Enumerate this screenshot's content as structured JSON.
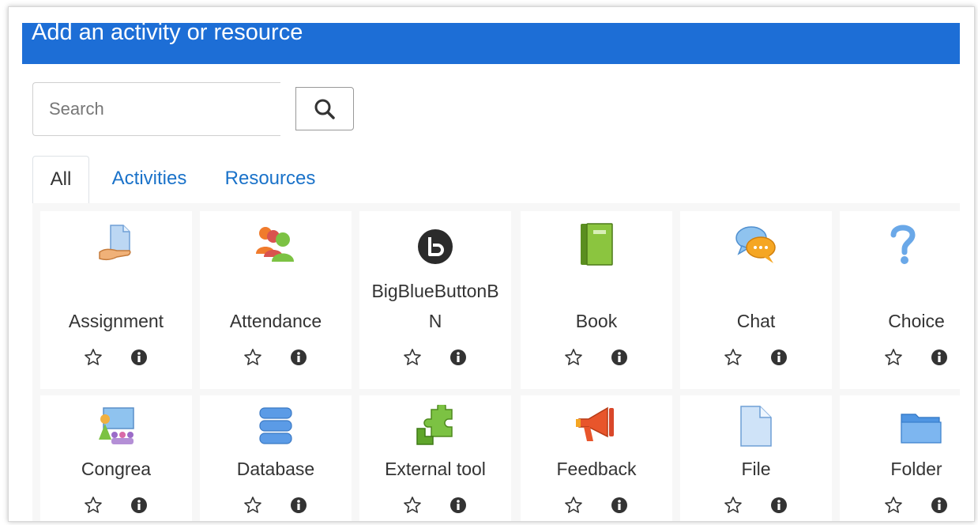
{
  "modal": {
    "title": "Add an activity or resource"
  },
  "search": {
    "placeholder": "Search"
  },
  "tabs": [
    {
      "label": "All",
      "active": true
    },
    {
      "label": "Activities",
      "active": false
    },
    {
      "label": "Resources",
      "active": false
    }
  ],
  "colors": {
    "header": "#1d6ed6",
    "link": "#1a72c9"
  },
  "modules": [
    {
      "name": "Assignment",
      "icon": "assignment-icon"
    },
    {
      "name": "Attendance",
      "icon": "attendance-icon"
    },
    {
      "name": "BigBlueButtonBN",
      "icon": "bigbluebutton-icon"
    },
    {
      "name": "Book",
      "icon": "book-icon"
    },
    {
      "name": "Chat",
      "icon": "chat-icon"
    },
    {
      "name": "Choice",
      "icon": "choice-icon"
    },
    {
      "name": "Congrea",
      "icon": "congrea-icon"
    },
    {
      "name": "Database",
      "icon": "database-icon"
    },
    {
      "name": "External tool",
      "icon": "puzzle-icon"
    },
    {
      "name": "Feedback",
      "icon": "megaphone-icon"
    },
    {
      "name": "File",
      "icon": "file-icon"
    },
    {
      "name": "Folder",
      "icon": "folder-icon"
    }
  ]
}
